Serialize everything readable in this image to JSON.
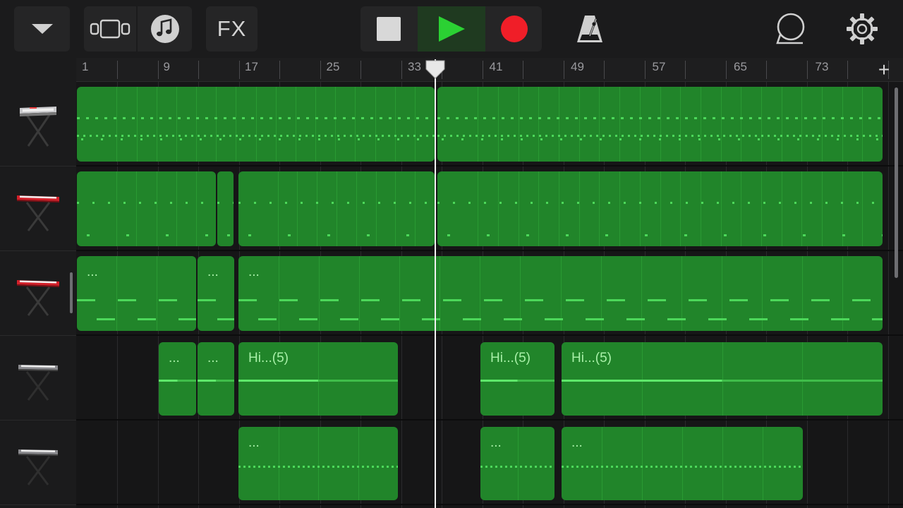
{
  "toolbar": {
    "browser_icon": "chevron-down-icon",
    "view_icon": "tracks-view-icon",
    "loops_icon": "music-note-icon",
    "fx_label": "FX",
    "metronome_icon": "metronome-icon",
    "master_icon": "loop-browser-icon",
    "settings_icon": "gear-icon"
  },
  "transport": {
    "stop_icon": "stop-icon",
    "play_icon": "play-icon",
    "record_icon": "record-icon",
    "play_active": true
  },
  "ruler": {
    "bar_numbers": [
      "1",
      "9",
      "17",
      "25",
      "33",
      "41",
      "49",
      "57",
      "65",
      "73"
    ],
    "add_label": "+"
  },
  "colors": {
    "region": "#21852a",
    "region_divider": "#2a9a33",
    "note": "#4cd85a",
    "record": "#f01e28",
    "play": "#2bd133"
  },
  "tracks": [
    {
      "instrument_icon": "synth-keyboard-silver-icon"
    },
    {
      "instrument_icon": "synth-keyboard-red-icon"
    },
    {
      "instrument_icon": "synth-keyboard-red-icon"
    },
    {
      "instrument_icon": "keyboard-stand-icon"
    },
    {
      "instrument_icon": "keyboard-stand-icon"
    }
  ],
  "region_labels": {
    "t3_r1": "...",
    "t3_r2": "...",
    "t3_r3": "...",
    "t4_r1": "...",
    "t4_r2": "...",
    "t4_r3": "Hi...(5)",
    "t4_r4": "Hi...(5)",
    "t4_r5": "Hi...(5)",
    "t5_r1": "...",
    "t5_r2": "...",
    "t5_r3": "..."
  }
}
